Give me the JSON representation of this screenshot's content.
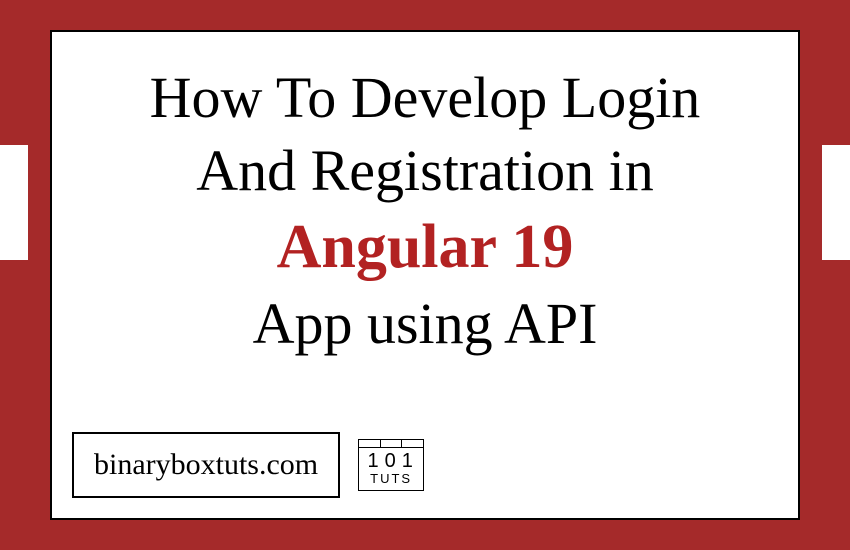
{
  "title": {
    "line1": "How To Develop Login",
    "line2": "And Registration in",
    "highlight": "Angular 19",
    "line4": "App using API"
  },
  "footer": {
    "site": "binaryboxtuts.com",
    "logo": {
      "number": "101",
      "text": "TUTS"
    }
  },
  "colors": {
    "frame": "#A52A2A",
    "highlight": "#B22222",
    "text": "#000000",
    "background": "#ffffff"
  }
}
